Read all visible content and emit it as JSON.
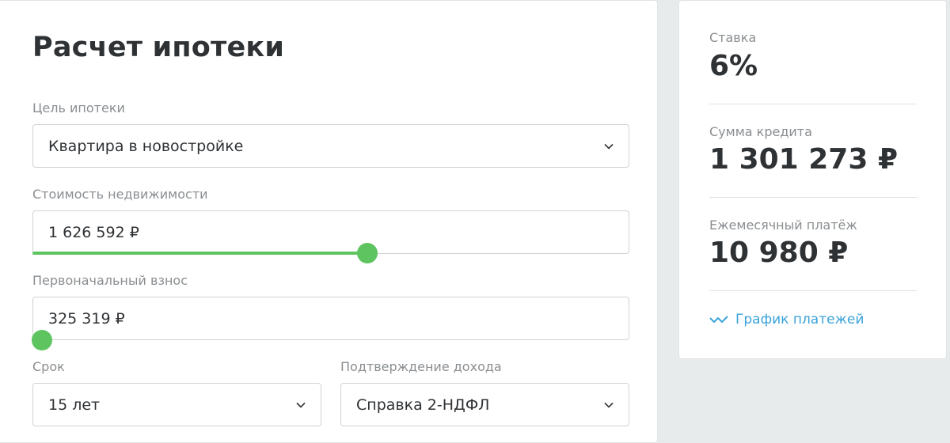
{
  "form": {
    "title": "Расчет ипотеки",
    "purpose_label": "Цель ипотеки",
    "purpose_value": "Квартира в новостройке",
    "property_cost_label": "Стоимость недвижимости",
    "property_cost_value": "1 626 592 ₽",
    "property_cost_slider_fraction": 0.56,
    "down_payment_label": "Первоначальный взнос",
    "down_payment_value": "325 319 ₽",
    "down_payment_slider_fraction": 0.0,
    "term_label": "Срок",
    "term_value": "15 лет",
    "income_label": "Подтверждение дохода",
    "income_value": "Справка 2-НДФЛ"
  },
  "summary": {
    "rate_label": "Ставка",
    "rate_value": "6%",
    "loan_label": "Сумма кредита",
    "loan_value": "1 301 273 ₽",
    "payment_label": "Ежемесячный платёж",
    "payment_value": "10 980 ₽",
    "schedule_link": "График платежей"
  },
  "colors": {
    "accent_green": "#5ec45f",
    "link_blue": "#3aa3d9"
  },
  "icons": {
    "dropdown": "chevron-down-icon",
    "schedule": "chart-line-icon"
  }
}
